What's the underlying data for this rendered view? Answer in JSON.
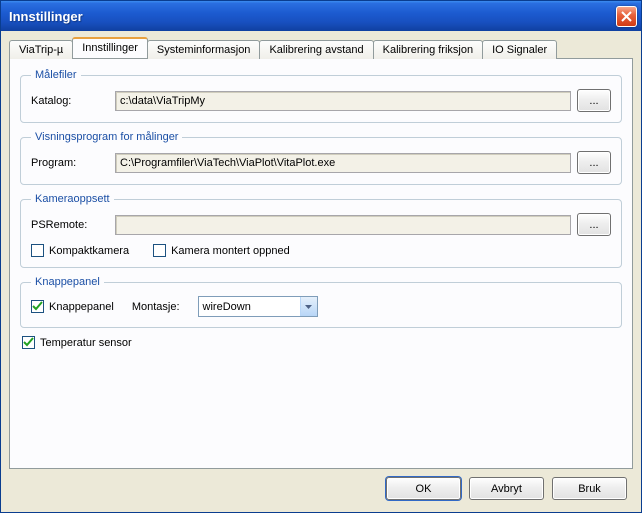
{
  "window": {
    "title": "Innstillinger"
  },
  "tabs": [
    {
      "label": "ViaTrip-µ"
    },
    {
      "label": "Innstillinger"
    },
    {
      "label": "Systeminformasjon"
    },
    {
      "label": "Kalibrering avstand"
    },
    {
      "label": "Kalibrering friksjon"
    },
    {
      "label": "IO Signaler"
    }
  ],
  "groups": {
    "malefiler": {
      "legend": "Målefiler",
      "katalog_label": "Katalog:",
      "katalog_value": "c:\\data\\ViaTripMy",
      "browse_label": "..."
    },
    "visning": {
      "legend": "Visningsprogram for målinger",
      "program_label": "Program:",
      "program_value": "C:\\Programfiler\\ViaTech\\ViaPlot\\VitaPlot.exe",
      "browse_label": "..."
    },
    "kamera": {
      "legend": "Kameraoppsett",
      "psremote_label": "PSRemote:",
      "psremote_value": "",
      "browse_label": "...",
      "kompakt_label": "Kompaktkamera",
      "montert_label": "Kamera montert oppned"
    },
    "knappe": {
      "legend": "Knappepanel",
      "knappe_label": "Knappepanel",
      "montasje_label": "Montasje:",
      "montasje_value": "wireDown"
    },
    "temp": {
      "label": "Temperatur sensor"
    }
  },
  "buttons": {
    "ok": "OK",
    "cancel": "Avbryt",
    "apply": "Bruk"
  }
}
